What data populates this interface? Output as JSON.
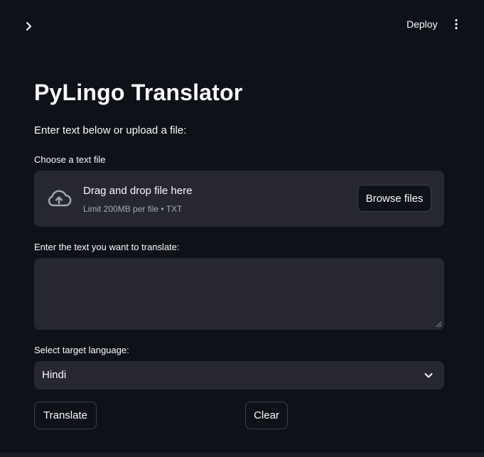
{
  "header": {
    "sidebar_toggle_icon": "chevron-right-icon",
    "deploy_label": "Deploy",
    "menu_icon": "vertical-ellipsis-icon"
  },
  "main": {
    "title": "PyLingo Translator",
    "intro": "Enter text below or upload a file:",
    "file_uploader": {
      "label": "Choose a text file",
      "icon": "cloud-upload-icon",
      "drag_text": "Drag and drop file here",
      "limit_text": "Limit 200MB per file • TXT",
      "browse_label": "Browse files"
    },
    "text_input": {
      "label": "Enter the text you want to translate:",
      "value": ""
    },
    "language_select": {
      "label": "Select target language:",
      "selected": "Hindi",
      "icon": "chevron-down-icon"
    },
    "buttons": {
      "translate_label": "Translate",
      "clear_label": "Clear"
    }
  },
  "colors": {
    "background": "#0e1117",
    "widget_background": "#262730",
    "border": "#3d4049",
    "text": "#fafafa",
    "muted_text": "#a3a8b4"
  }
}
